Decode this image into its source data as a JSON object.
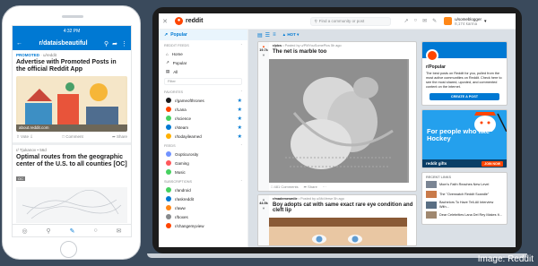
{
  "phone": {
    "status_time": "4:32 PM",
    "header_title": "r/dataisbeautiful",
    "post1": {
      "promoted_label": "PROMOTED",
      "author": "u/reddit",
      "title": "Advertise with Promoted Posts in the official Reddit App",
      "link_domain": "about.reddit.com",
      "vote_label": "Vote",
      "comment_label": "Comment",
      "share_label": "Share"
    },
    "post2": {
      "meta": "r/ Tjukanov • 56d",
      "title": "Optimal routes from the geographic center of the U.S. to all counties [OC]",
      "flair": "OC"
    }
  },
  "desktop": {
    "topbar": {
      "close_icon": "close-icon",
      "logo_text": "reddit",
      "search_placeholder": "Find a community or post",
      "username": "u/someblogger",
      "karma": "8,174 karma"
    },
    "sidebar": {
      "popular": "Popular",
      "feeds_header": "REDDIT FEEDS",
      "feeds": [
        "Home",
        "Popular",
        "All"
      ],
      "filter_placeholder": "Filter",
      "favorites_header": "FAVORITES",
      "favorites": [
        "r/gameofthrones",
        "r/Lana",
        "r/science",
        "r/steam",
        "r/todayilearned"
      ],
      "feeds2_header": "FEEDS",
      "feeds2": [
        "Oopticurosity",
        "Gaming",
        "Music"
      ],
      "subscriptions_header": "SUBSCRIPTIONS",
      "subscriptions": [
        "r/android",
        "r/askreddit",
        "r/aww",
        "r/boxes",
        "r/changemyview"
      ]
    },
    "viewbar": {
      "sort": "HOT"
    },
    "feed": {
      "post1": {
        "score": "19.7k",
        "subreddit": "r/pics",
        "meta": "• Posted by u/PMYouSomePics 5h ago",
        "title": "The net is marble too",
        "comments": "481 Comments",
        "share": "Share"
      },
      "post2": {
        "score": "44.5k",
        "subreddit": "r/mademesmile",
        "meta": "• Posted by u/MoVerse 5h ago",
        "title": "Boy adopts cat with same exact rare eye condition and cleft lip"
      }
    },
    "community": {
      "name": "r/Popular",
      "description": "The best posts on Reddit for you, pulled from the most active communities on Reddit. Check here to see the most shared, upvoted, and commented content on the internet.",
      "button": "CREATE A POST"
    },
    "ad": {
      "text": "For people who like Hockey",
      "brand": "reddit gifts",
      "join": "JOIN NOW"
    },
    "recent": {
      "header": "RECENT LINKS",
      "items": [
        "Mom's Faith Reaches New Level",
        "The \"Overwatch Reddit Scandle\"",
        "Bachelors To Have Tell-All Interview With...",
        "Dear Celebrities Lana Del Rey Makes It..."
      ]
    }
  },
  "credit": "Image: Reddit"
}
